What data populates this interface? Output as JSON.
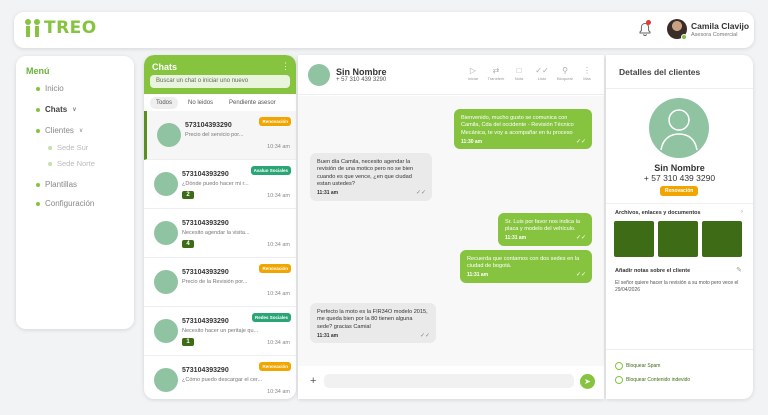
{
  "brand": {
    "logo_text": "TREO"
  },
  "header": {
    "user_name": "Camila Clavijo",
    "user_role": "Asesora Comercial"
  },
  "sidebar": {
    "title": "Menú",
    "items": [
      {
        "label": "Inicio"
      },
      {
        "label": "Chats"
      },
      {
        "label": "Clientes"
      },
      {
        "label": "Sede Sur"
      },
      {
        "label": "Sede Norte"
      },
      {
        "label": "Plantillas"
      },
      {
        "label": "Configuración"
      }
    ]
  },
  "chatlist": {
    "title": "Chats",
    "search_placeholder": "Buscar un chat o iniciar uno nuevo",
    "filters": [
      "Todos",
      "No leidos",
      "Pendiente asesor"
    ],
    "items": [
      {
        "phone": "573104393290",
        "preview": "Precio del servicio por...",
        "time": "10:34 am",
        "tag": "Renovación",
        "tag_color": "#f0a500",
        "count": ""
      },
      {
        "phone": "573104393290",
        "preview": "¿Dónde puedo hacer mi r...",
        "time": "10:34 am",
        "tag": "Avaluo Sociales",
        "tag_color": "#2aa676",
        "count": "2"
      },
      {
        "phone": "573104393290",
        "preview": "Necesito agendar la visita...",
        "time": "10:34 am",
        "tag": "",
        "tag_color": "",
        "count": "4"
      },
      {
        "phone": "573104393290",
        "preview": "Precio de la Revisión por...",
        "time": "10:34 am",
        "tag": "Renovación",
        "tag_color": "#f0a500",
        "count": ""
      },
      {
        "phone": "573104393290",
        "preview": "Necesito hacer un peritaje qu...",
        "time": "10:34 am",
        "tag": "Redes Sociales",
        "tag_color": "#2aa676",
        "count": "1"
      },
      {
        "phone": "573104393290",
        "preview": "¿Cómo puedo descargar el cer...",
        "time": "10:34 am",
        "tag": "Renovación",
        "tag_color": "#f0a500",
        "count": ""
      }
    ]
  },
  "chat": {
    "contact_name": "Sin Nombre",
    "contact_phone": "+ 57 310 439 3290",
    "toolbar": [
      "Iniciar",
      "Transferir",
      "Nota",
      "Listo",
      "Bloquear",
      "Más"
    ],
    "messages": [
      {
        "dir": "out",
        "text": "Bienvenido, mucho gusto se comunica con Camila, Cda del occidente - Revisión Técnico Mecánica, te voy a acompañar en tu proceso",
        "time": "11:30 am"
      },
      {
        "dir": "in",
        "text": "Buen día Camila, necesito agendar la revisión de una motico pero no se bien cuando es que vence, ¿en que ciudad estan ustedes?",
        "time": "11:31 am"
      },
      {
        "dir": "out",
        "text": "Sr. Luis por favor nos indica la placa y modelo del vehículo.",
        "time": "11:31 am"
      },
      {
        "dir": "out",
        "text": "Recuerda que contamos con dos sedes en la ciudad de bogotá.",
        "time": "11:31 am"
      },
      {
        "dir": "in",
        "text": "Perfecto la moto es la FIR34O modelo 2015, me queda bien por la 80 tienen alguna sede? gracias Camial",
        "time": "11:31 am"
      }
    ]
  },
  "details": {
    "title": "Detalles del clientes",
    "name": "Sin Nombre",
    "phone": "+ 57 310 439 3290",
    "tag": "Renovación",
    "files_title": "Archivos, enlaces y documentos",
    "notes_title": "Añadir notas sobre el cliente",
    "note_text": "El señor quiere hacer la revisión a su moto pero vece el 29/04/2026",
    "block_spam": "Bloquear Spam",
    "block_inappropriate": "Bloquear Contenido indevido"
  },
  "colors": {
    "brand": "#86c440",
    "dark_green": "#3e6c16",
    "orange": "#f0a500"
  }
}
